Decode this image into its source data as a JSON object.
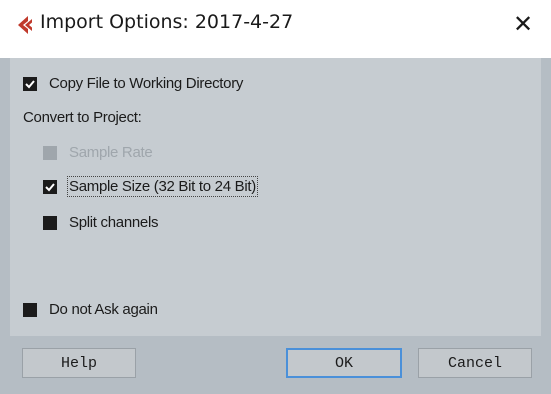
{
  "window": {
    "title": "Import Options: 2017-4-27",
    "close_glyph": "✕",
    "app_icon": "cubase-logo-icon",
    "accent_color": "#c0392b"
  },
  "options": {
    "copy_file": {
      "label": "Copy File to Working Directory",
      "checked": true
    },
    "convert_heading": "Convert to Project:",
    "sample_rate": {
      "label": "Sample Rate",
      "checked": false,
      "disabled": true
    },
    "sample_size": {
      "label": "Sample Size (32 Bit to 24 Bit)",
      "checked": true
    },
    "split_channels": {
      "label": "Split channels",
      "checked": false
    },
    "do_not_ask": {
      "label": "Do not Ask again",
      "checked": false
    }
  },
  "buttons": {
    "help": "Help",
    "ok": "OK",
    "cancel": "Cancel"
  }
}
